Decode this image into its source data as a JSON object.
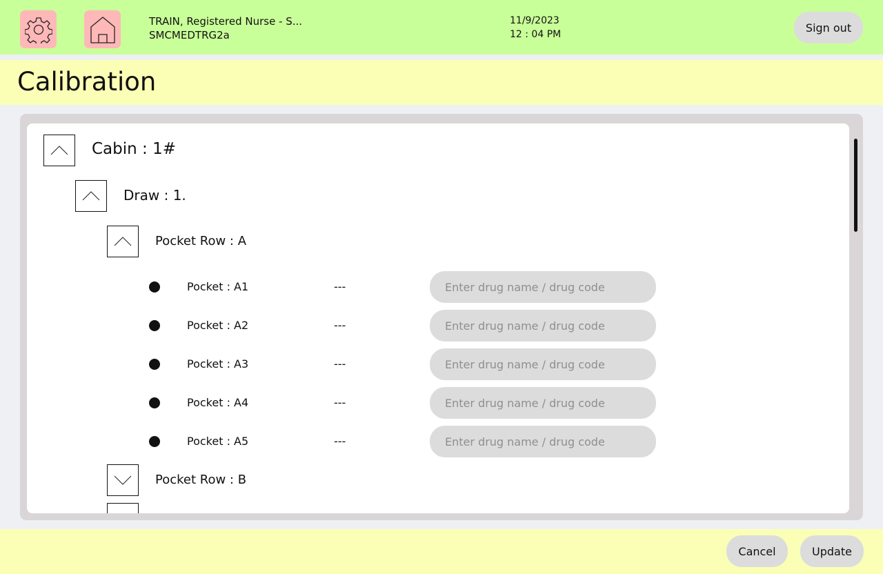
{
  "header": {
    "settings_icon": "gear-icon",
    "home_icon": "home-icon",
    "user_line1": "TRAIN, Registered Nurse - S...",
    "user_line2": "SMCMEDTRG2a",
    "date": "11/9/2023",
    "time": "12 : 04 PM",
    "signout_label": "Sign out"
  },
  "page": {
    "title": "Calibration"
  },
  "tree": {
    "cabin": {
      "label": "Cabin  :  1#",
      "icon": "chevron-up-icon",
      "draw": {
        "label": "Draw  :  1.",
        "icon": "chevron-up-icon",
        "rows": [
          {
            "label": "Pocket Row  :  A",
            "icon": "chevron-up-icon",
            "pockets": [
              {
                "label": "Pocket  :  A1",
                "value": "---",
                "placeholder": "Enter drug name / drug code"
              },
              {
                "label": "Pocket  :  A2",
                "value": "---",
                "placeholder": "Enter drug name / drug code"
              },
              {
                "label": "Pocket  :  A3",
                "value": "---",
                "placeholder": "Enter drug name / drug code"
              },
              {
                "label": "Pocket  :  A4",
                "value": "---",
                "placeholder": "Enter drug name / drug code"
              },
              {
                "label": "Pocket  :  A5",
                "value": "---",
                "placeholder": "Enter drug name / drug code"
              }
            ]
          },
          {
            "label": "Pocket Row  :  B",
            "icon": "chevron-down-icon"
          }
        ]
      }
    }
  },
  "footer": {
    "cancel_label": "Cancel",
    "update_label": "Update"
  },
  "colors": {
    "header_bg": "#c9ff99",
    "title_bg": "#fbffb5",
    "icon_button_bg": "#ffb8b8",
    "pill_bg": "#dcdcdc",
    "panel_bg": "#dad6d7"
  }
}
